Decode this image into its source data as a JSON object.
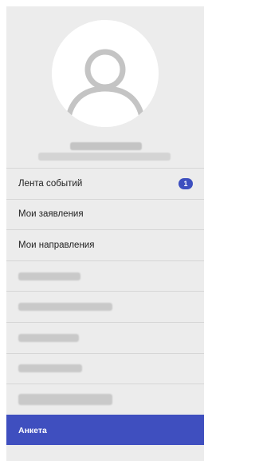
{
  "menu": {
    "items": [
      {
        "label": "Лента событий",
        "badge": "1"
      },
      {
        "label": "Мои заявления"
      },
      {
        "label": "Мои направления"
      }
    ],
    "active_label": "Анкета"
  },
  "colors": {
    "sidebar_bg": "#ececec",
    "accent": "#3f4fbf",
    "badge": "#3d4fbf"
  }
}
